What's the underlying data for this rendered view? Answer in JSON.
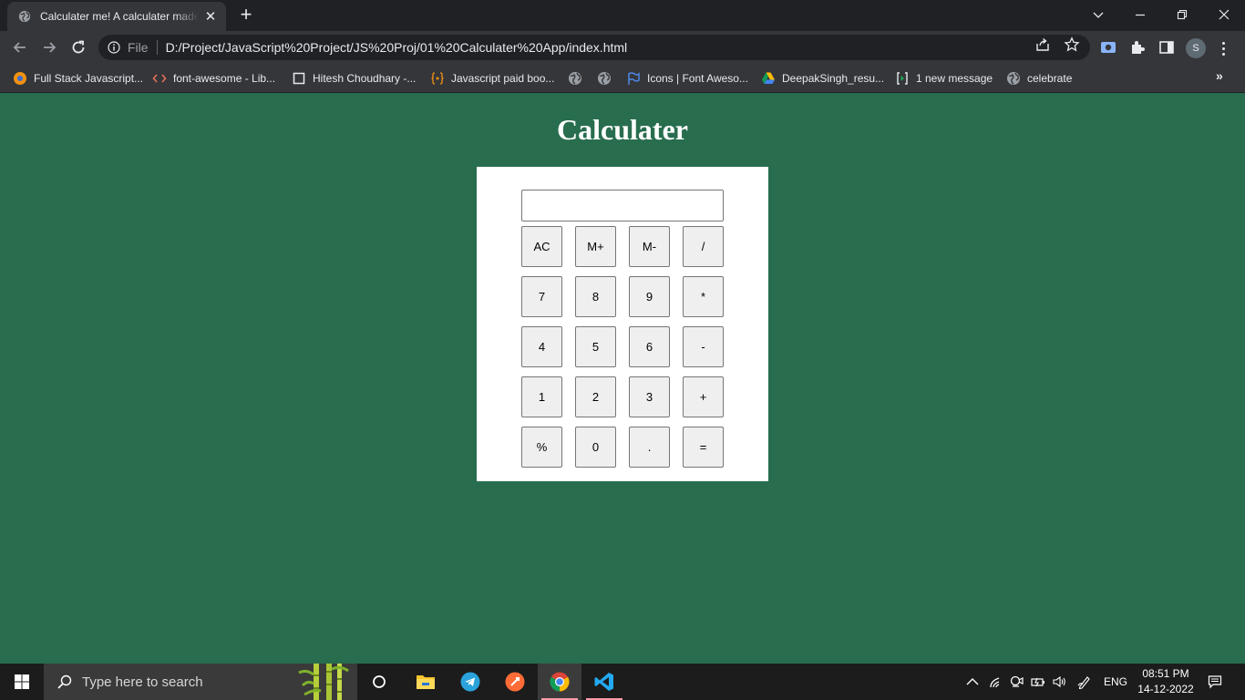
{
  "browser": {
    "tab_title": "Calculater me! A calculater made",
    "url_scheme_label": "File",
    "url": "D:/Project/JavaScript%20Project/JS%20Proj/01%20Calculater%20App/index.html",
    "profile_initial": "S",
    "bookmarks": [
      {
        "label": "Full Stack Javascript...",
        "icon": "orange-circle-icon"
      },
      {
        "label": "font-awesome - Lib...",
        "icon": "code-brackets-icon"
      },
      {
        "label": "Hitesh Choudhary -...",
        "icon": "square-outline-icon"
      },
      {
        "label": "Javascript paid boo...",
        "icon": "braces-icon"
      },
      {
        "label": "",
        "icon": "globe-icon"
      },
      {
        "label": "",
        "icon": "globe-icon"
      },
      {
        "label": "Icons | Font Aweso...",
        "icon": "flag-icon"
      },
      {
        "label": "DeepakSingh_resu...",
        "icon": "google-drive-icon"
      },
      {
        "label": "1 new message",
        "icon": "bracket-message-icon"
      },
      {
        "label": "celebrate",
        "icon": "globe-icon"
      }
    ]
  },
  "page": {
    "title": "Calculater",
    "display_value": "",
    "keys": [
      "AC",
      "M+",
      "M-",
      "/",
      "7",
      "8",
      "9",
      "*",
      "4",
      "5",
      "6",
      "-",
      "1",
      "2",
      "3",
      "+",
      "%",
      "0",
      ".",
      "="
    ]
  },
  "taskbar": {
    "search_placeholder": "Type here to search",
    "language": "ENG",
    "time": "08:51 PM",
    "date": "14-12-2022"
  },
  "colors": {
    "page_background": "#286d4e",
    "calculator_background": "#ffffff",
    "key_background": "#efefef"
  }
}
